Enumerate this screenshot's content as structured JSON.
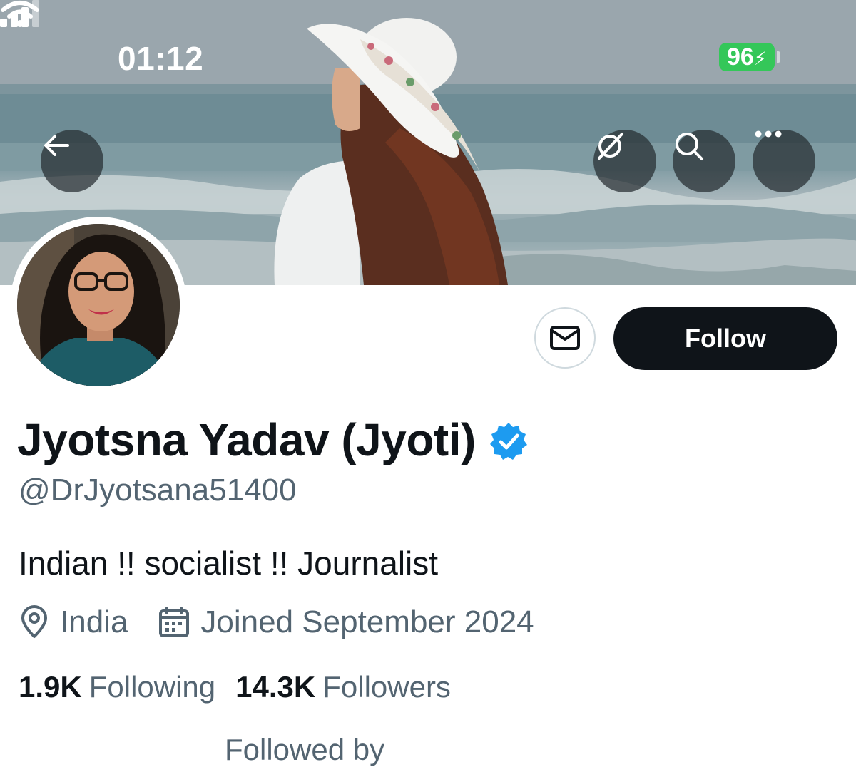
{
  "status_bar": {
    "time": "01:12",
    "battery": "96"
  },
  "nav": {
    "back_icon": "arrow-left-icon",
    "grok_icon": "grok-icon",
    "search_icon": "search-icon",
    "more_icon": "more-horizontal-icon"
  },
  "actions": {
    "message_icon": "envelope-icon",
    "follow_label": "Follow"
  },
  "profile": {
    "display_name": "Jyotsna Yadav (Jyoti)",
    "verified": true,
    "handle": "@DrJyotsana51400",
    "bio": "Indian !! socialist !! Journalist",
    "location": "India",
    "joined": "Joined September 2024"
  },
  "stats": {
    "following_count": "1.9K",
    "following_label": "Following",
    "followers_count": "14.3K",
    "followers_label": "Followers"
  },
  "followed_by": "Followed by",
  "colors": {
    "accent_verified": "#1d9bf0",
    "primary_text": "#0f1419",
    "secondary_text": "#536471",
    "battery": "#34c759",
    "follow_button_bg": "#0f1419"
  }
}
